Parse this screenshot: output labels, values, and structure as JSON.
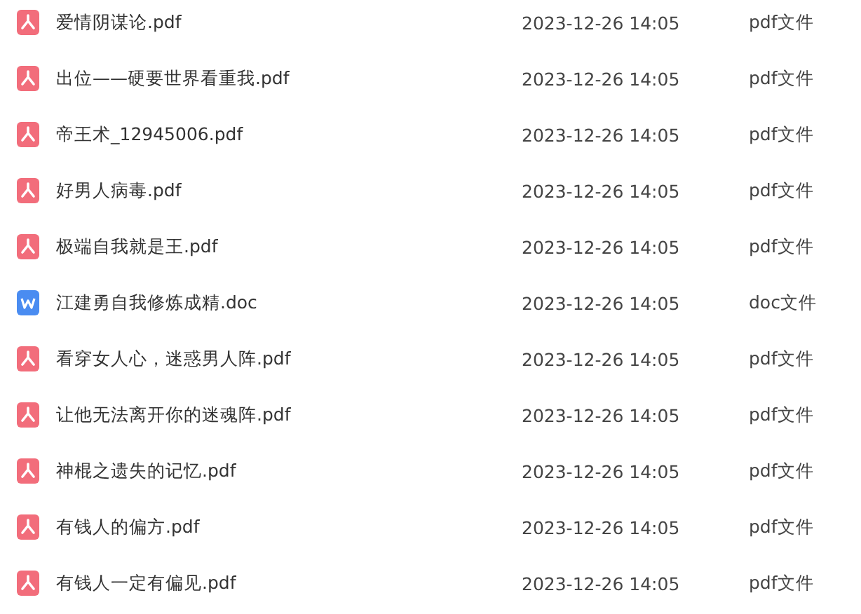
{
  "files": [
    {
      "kind": "pdf",
      "name": "爱情阴谋论.pdf",
      "modified": "2023-12-26 14:05",
      "type": "pdf文件"
    },
    {
      "kind": "pdf",
      "name": "出位——硬要世界看重我.pdf",
      "modified": "2023-12-26 14:05",
      "type": "pdf文件"
    },
    {
      "kind": "pdf",
      "name": "帝王术_12945006.pdf",
      "modified": "2023-12-26 14:05",
      "type": "pdf文件"
    },
    {
      "kind": "pdf",
      "name": "好男人病毒.pdf",
      "modified": "2023-12-26 14:05",
      "type": "pdf文件"
    },
    {
      "kind": "pdf",
      "name": "极端自我就是王.pdf",
      "modified": "2023-12-26 14:05",
      "type": "pdf文件"
    },
    {
      "kind": "doc",
      "name": "江建勇自我修炼成精.doc",
      "modified": "2023-12-26 14:05",
      "type": "doc文件"
    },
    {
      "kind": "pdf",
      "name": "看穿女人心，迷惑男人阵.pdf",
      "modified": "2023-12-26 14:05",
      "type": "pdf文件"
    },
    {
      "kind": "pdf",
      "name": "让他无法离开你的迷魂阵.pdf",
      "modified": "2023-12-26 14:05",
      "type": "pdf文件"
    },
    {
      "kind": "pdf",
      "name": "神棍之遗失的记忆.pdf",
      "modified": "2023-12-26 14:05",
      "type": "pdf文件"
    },
    {
      "kind": "pdf",
      "name": "有钱人的偏方.pdf",
      "modified": "2023-12-26 14:05",
      "type": "pdf文件"
    },
    {
      "kind": "pdf",
      "name": "有钱人一定有偏见.pdf",
      "modified": "2023-12-26 14:05",
      "type": "pdf文件"
    }
  ]
}
